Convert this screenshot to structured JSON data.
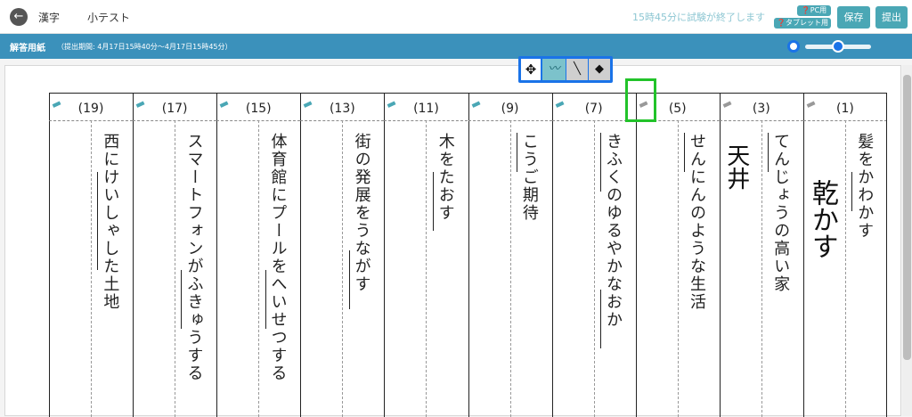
{
  "header": {
    "back_icon": "arrow-left-icon",
    "subject": "漢字",
    "test_name": "小テスト",
    "end_notice": "15時45分に試験が終了します",
    "pc_mode": "PC用",
    "tablet_mode": "タブレット用",
    "save_label": "保存",
    "submit_label": "提出"
  },
  "bar": {
    "title": "解答用紙",
    "period": "（提出期間: 4月17日15時40分〜4月17日15時45分）"
  },
  "toolbar": {
    "tools": [
      "move-icon",
      "pen-icon",
      "line-icon",
      "eraser-icon"
    ],
    "move_glyph": "✥",
    "pen_glyph": "〰",
    "line_glyph": "╲",
    "eraser_glyph": "◆"
  },
  "sheet": {
    "columns": [
      {
        "number": "(19)",
        "question": "西にけいしゃした土地",
        "answer": ""
      },
      {
        "number": "(17)",
        "question": "スマートフォンがふきゅうする",
        "answer": ""
      },
      {
        "number": "(15)",
        "question": "体育館にプールをへいせつする",
        "answer": ""
      },
      {
        "number": "(13)",
        "question": "街の発展をうながす",
        "answer": ""
      },
      {
        "number": "(11)",
        "question": "木をたおす",
        "answer": ""
      },
      {
        "number": "(9)",
        "question": "こうご期待",
        "answer": ""
      },
      {
        "number": "(7)",
        "question": "きふくのゆるやかなおか",
        "answer": ""
      },
      {
        "number": "(5)",
        "question": "せんにんのような生活",
        "answer": ""
      },
      {
        "number": "(3)",
        "question": "てんじょうの高い家",
        "answer": "天井"
      },
      {
        "number": "(1)",
        "question": "髪をかわかす",
        "answer": "乾かす"
      }
    ]
  }
}
